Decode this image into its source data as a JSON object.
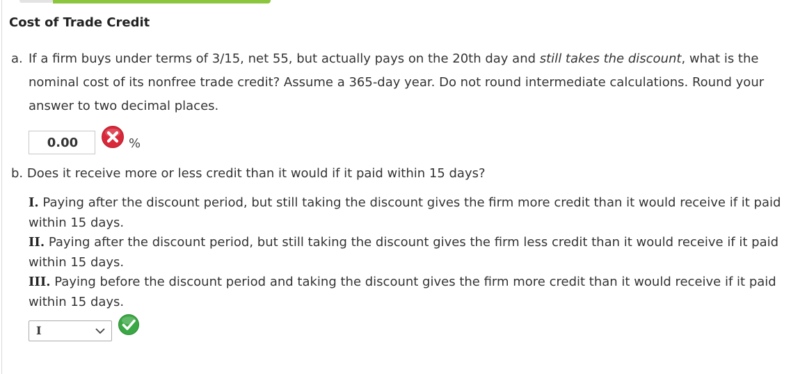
{
  "title": "Cost of Trade Credit",
  "part_a": {
    "prefix": "a.",
    "text_1": "If a firm buys under terms of 3/15, net 55, but actually pays on the 20th day and ",
    "text_italic": "still takes the discount",
    "text_2": ", what is the nominal cost of its nonfree trade credit? Assume a 365-day year. Do not round intermediate calculations. Round your answer to two decimal places.",
    "answer_value": "0.00",
    "unit": "%",
    "answer_status_icon": "incorrect-x-icon"
  },
  "part_b": {
    "question": "b. Does it receive more or less credit than it would if it paid within 15 days?",
    "options": [
      {
        "numeral": "I.",
        "text": "Paying after the discount period, but still taking the discount gives the firm more credit than it would receive if it paid within 15 days."
      },
      {
        "numeral": "II.",
        "text": "Paying after the discount period, but still taking the discount gives the firm less credit than it would receive if it paid within 15 days."
      },
      {
        "numeral": "III.",
        "text": "Paying before the discount period and taking the discount gives the firm more credit than it would receive if it paid within 15 days."
      }
    ],
    "selected": "I",
    "answer_status_icon": "correct-check-icon"
  },
  "colors": {
    "accent_green": "#8cc63f",
    "error_red": "#d8283a",
    "success_green": "#3aa844"
  }
}
